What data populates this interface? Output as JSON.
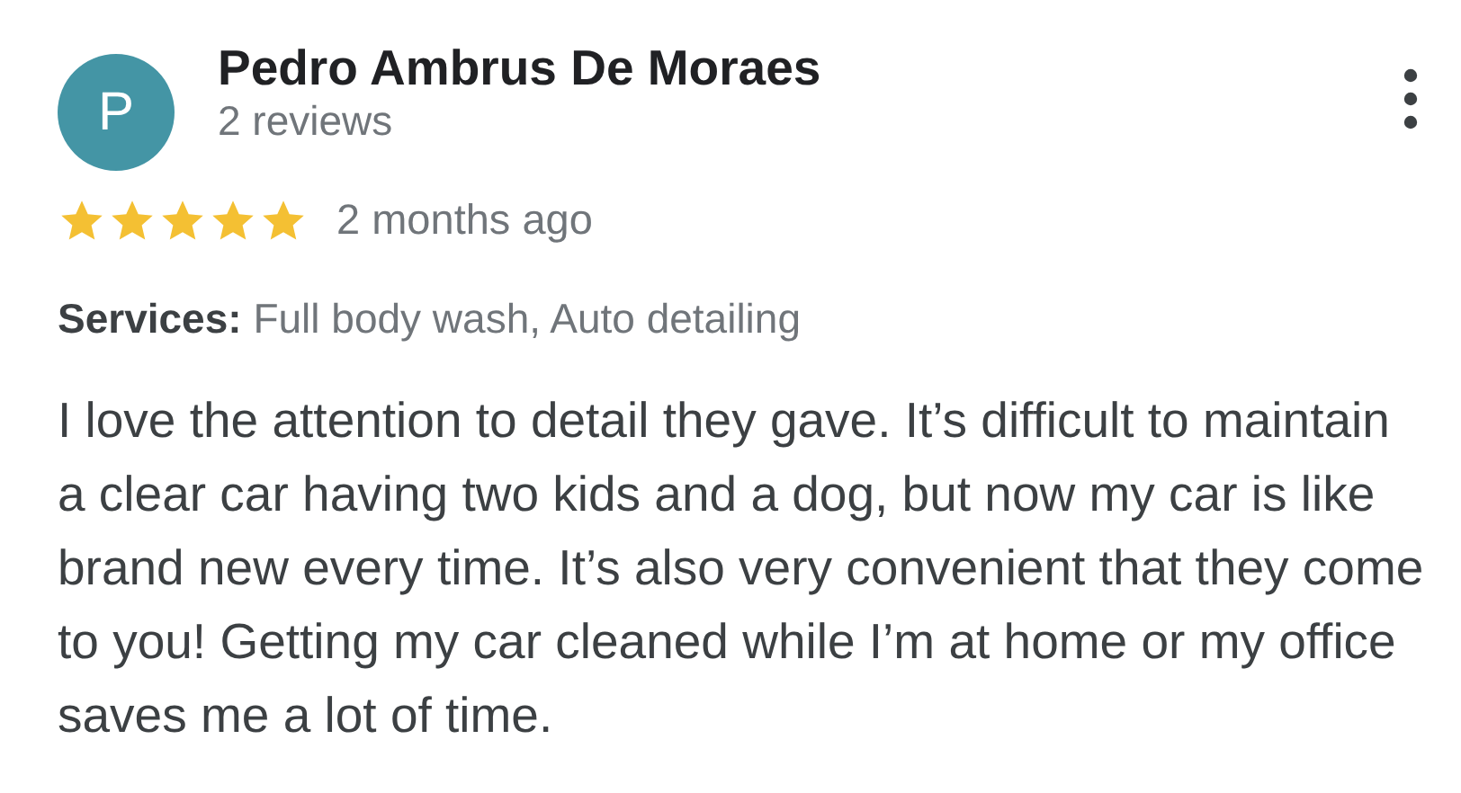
{
  "review": {
    "avatar_letter": "P",
    "author": "Pedro Ambrus De Moraes",
    "review_count": "2 reviews",
    "stars": 5,
    "time": "2 months ago",
    "services": "**Services:** Full body wash, Auto detailing",
    "text": "I love the attention to detail they gave. It’s difficult to maintain a clear car having two kids and a dog, but now my car is like brand new every time. It’s also very convenient that they come to you! Getting my car cleaned while I’m at home or my office saves me a lot of time."
  }
}
